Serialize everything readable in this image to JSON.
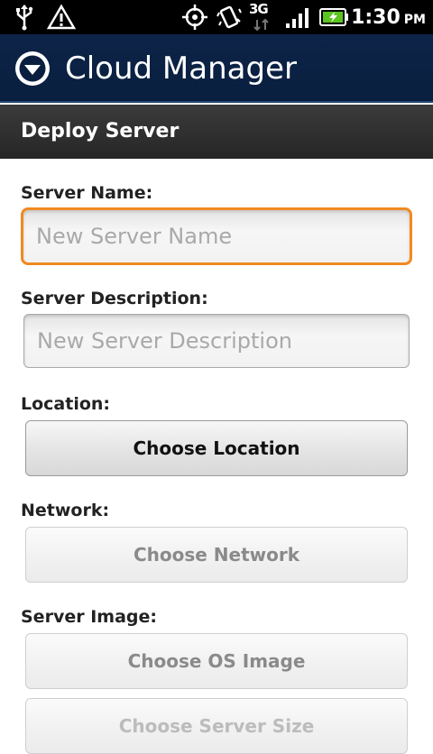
{
  "status_bar": {
    "icons": [
      "usb-icon",
      "warning-icon",
      "gps-icon",
      "vibrate-icon",
      "network-3g-icon",
      "signal-icon",
      "battery-charging-icon"
    ],
    "network_type": "3G",
    "time": "1:30",
    "ampm": "PM"
  },
  "app_bar": {
    "title": "Cloud Manager",
    "menu_icon": "chevron-down-circle-icon"
  },
  "section": {
    "title": "Deploy Server"
  },
  "form": {
    "server_name": {
      "label": "Server Name:",
      "placeholder": "New Server Name",
      "value": ""
    },
    "server_description": {
      "label": "Server Description:",
      "placeholder": "New Server Description",
      "value": ""
    },
    "location": {
      "label": "Location:",
      "button": "Choose Location"
    },
    "network": {
      "label": "Network:",
      "button": "Choose Network"
    },
    "server_image": {
      "label": "Server Image:",
      "button": "Choose OS Image",
      "next_button": "Choose Server Size"
    }
  },
  "colors": {
    "title_bar": "#0c2448",
    "section_bar": "#333333",
    "focus_border": "#f08a1f",
    "disabled_text": "#8a8a8a"
  }
}
